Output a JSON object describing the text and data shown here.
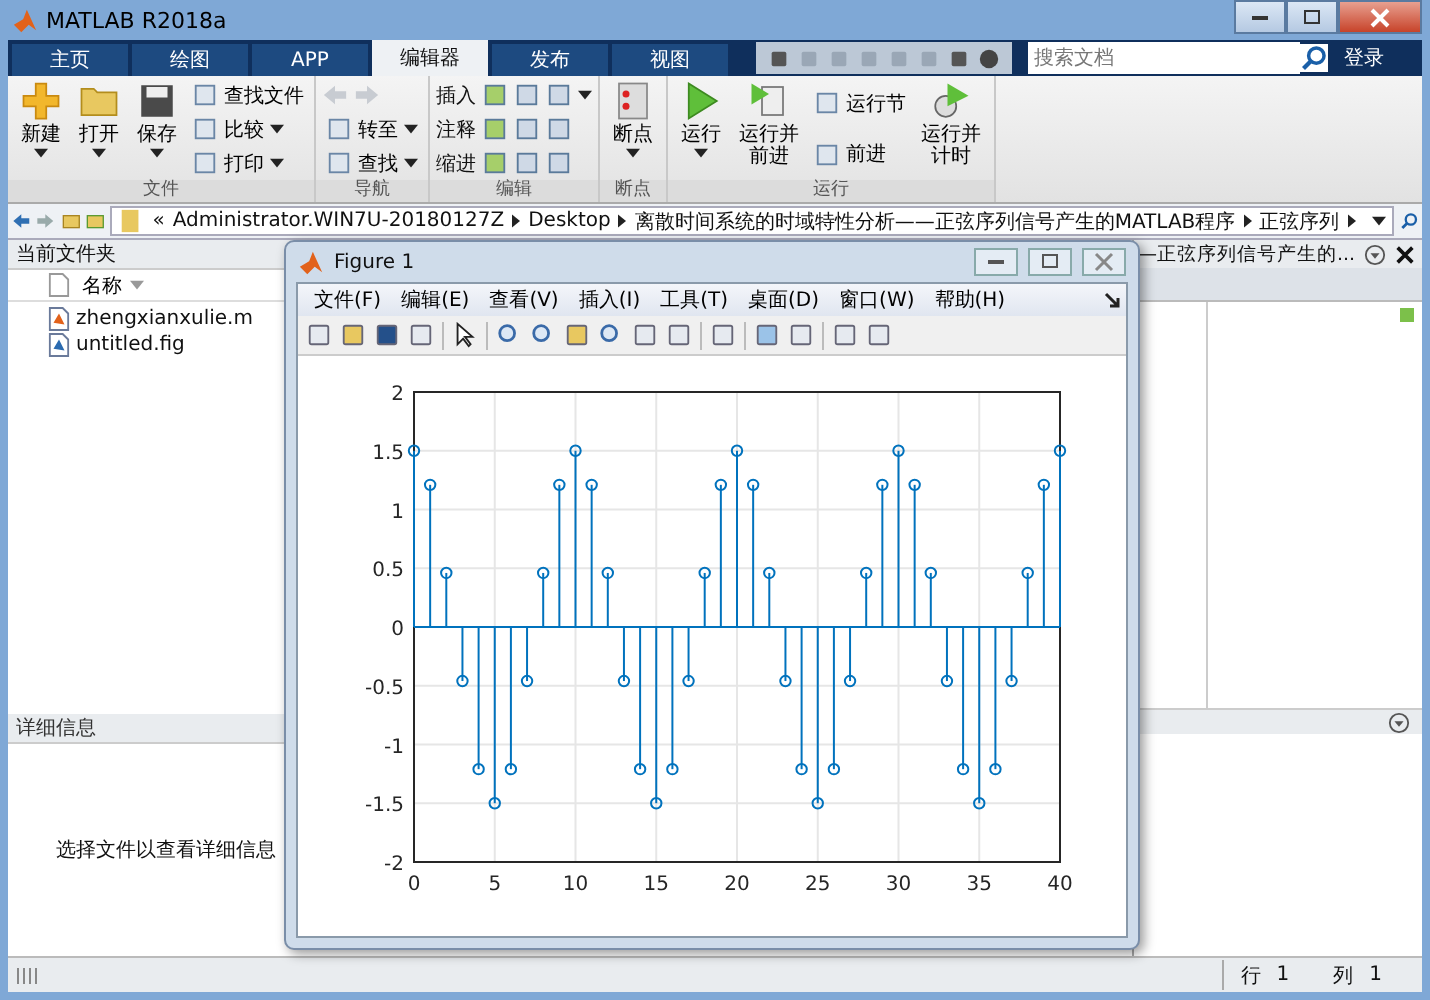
{
  "window": {
    "title": "MATLAB R2018a"
  },
  "tabs": [
    {
      "label": "主页",
      "selected": false
    },
    {
      "label": "绘图",
      "selected": false
    },
    {
      "label": "APP",
      "selected": false
    },
    {
      "label": "编辑器",
      "selected": true
    },
    {
      "label": "发布",
      "selected": false
    },
    {
      "label": "视图",
      "selected": false
    }
  ],
  "search": {
    "placeholder": "搜索文档"
  },
  "login": "登录",
  "ribbon": {
    "groups": [
      {
        "label": "文件",
        "blocks": [
          {
            "kind": "large",
            "label": "新建",
            "dropdown": true
          },
          {
            "kind": "large",
            "label": "打开",
            "dropdown": true
          },
          {
            "kind": "large",
            "label": "保存",
            "dropdown": true
          },
          {
            "kind": "stack",
            "items": [
              {
                "kind": "small",
                "label": "查找文件",
                "dropdown": false
              },
              {
                "kind": "small",
                "label": "比较",
                "dropdown": true
              },
              {
                "kind": "small",
                "label": "打印",
                "dropdown": true
              }
            ]
          }
        ]
      },
      {
        "label": "导航",
        "blocks": [
          {
            "kind": "stack",
            "items": [
              {
                "kind": "arrows"
              },
              {
                "kind": "small",
                "label": "转至",
                "dropdown": true
              },
              {
                "kind": "small",
                "label": "查找",
                "dropdown": true
              }
            ]
          }
        ]
      },
      {
        "label": "编辑",
        "blocks": [
          {
            "kind": "stack",
            "items": [
              {
                "kind": "tools",
                "label": "插入",
                "dropdown": true
              },
              {
                "kind": "tools",
                "label": "注释",
                "dropdown": false
              },
              {
                "kind": "tools",
                "label": "缩进",
                "dropdown": false
              }
            ]
          }
        ]
      },
      {
        "label": "断点",
        "blocks": [
          {
            "kind": "large",
            "label": "断点",
            "dropdown": true
          }
        ]
      },
      {
        "label": "运行",
        "blocks": [
          {
            "kind": "large",
            "label": "运行",
            "dropdown": true
          },
          {
            "kind": "large",
            "label": "运行并前进",
            "dropdown": false
          },
          {
            "kind": "stack",
            "items": [
              {
                "kind": "small",
                "label": "运行节",
                "dropdown": false
              },
              {
                "kind": "small",
                "label": "前进",
                "dropdown": false
              }
            ]
          },
          {
            "kind": "large",
            "label": "运行并计时",
            "dropdown": false
          }
        ]
      }
    ]
  },
  "address": {
    "prefix": "«",
    "segments": [
      "Administrator.WIN7U-20180127Z",
      "Desktop",
      "离散时间系统的时域特性分析——正弦序列信号产生的MATLAB程序",
      "正弦序列"
    ]
  },
  "folder_panel": {
    "title": "当前文件夹",
    "column": "名称",
    "files": [
      {
        "name": "zhengxianxulie.m",
        "kind": "m"
      },
      {
        "name": "untitled.fig",
        "kind": "fig"
      }
    ]
  },
  "details": {
    "title": "详细信息",
    "message": "选择文件以查看详细信息"
  },
  "editor": {
    "title": "—正弦序列信号产生的..."
  },
  "figure": {
    "title": "Figure 1",
    "menus": [
      "文件(F)",
      "编辑(E)",
      "查看(V)",
      "插入(I)",
      "工具(T)",
      "桌面(D)",
      "窗口(W)",
      "帮助(H)"
    ],
    "chart_data": {
      "type": "scatter",
      "grid": true,
      "x": [
        0,
        1,
        2,
        3,
        4,
        5,
        6,
        7,
        8,
        9,
        10,
        11,
        12,
        13,
        14,
        15,
        16,
        17,
        18,
        19,
        20,
        21,
        22,
        23,
        24,
        25,
        26,
        27,
        28,
        29,
        30,
        31,
        32,
        33,
        34,
        35,
        36,
        37,
        38,
        39,
        40
      ],
      "series": [
        {
          "color": "#0072bd",
          "values": [
            1.5,
            1.21,
            0.46,
            -0.46,
            -1.21,
            -1.5,
            -1.21,
            -0.46,
            0.46,
            1.21,
            1.5,
            1.21,
            0.46,
            -0.46,
            -1.21,
            -1.5,
            -1.21,
            -0.46,
            0.46,
            1.21,
            1.5,
            1.21,
            0.46,
            -0.46,
            -1.21,
            -1.5,
            -1.21,
            -0.46,
            0.46,
            1.21,
            1.5,
            1.21,
            0.46,
            -0.46,
            -1.21,
            -1.5,
            -1.21,
            -0.46,
            0.46,
            1.21,
            1.5
          ]
        }
      ],
      "ref_lines": [
        {
          "value": 0,
          "axis": "y",
          "color": "#0072bd"
        }
      ],
      "xlim": [
        0,
        40
      ],
      "ylim": [
        -2,
        2
      ],
      "xticks": [
        0,
        5,
        10,
        15,
        20,
        25,
        30,
        35,
        40
      ],
      "yticks": [
        -2,
        -1.5,
        -1,
        -0.5,
        0,
        0.5,
        1,
        1.5,
        2
      ]
    }
  },
  "status_bar": {
    "row_label": "行",
    "row_value": "1",
    "col_label": "列",
    "col_value": "1"
  }
}
